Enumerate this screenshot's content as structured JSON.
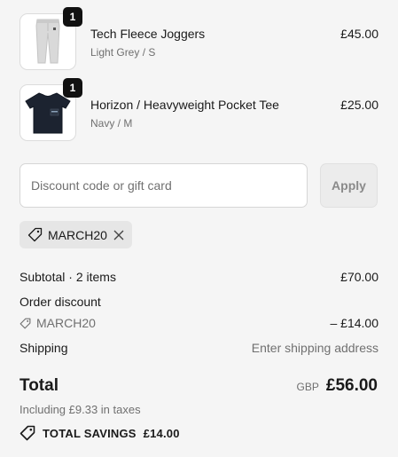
{
  "items": [
    {
      "name": "Tech Fleece Joggers",
      "variant": "Light Grey / S",
      "price": "£45.00",
      "quantity": "1",
      "image": "joggers-image"
    },
    {
      "name": "Horizon / Heavyweight Pocket Tee",
      "variant": "Navy / M",
      "price": "£25.00",
      "quantity": "1",
      "image": "tee-image"
    }
  ],
  "discount": {
    "placeholder": "Discount code or gift card",
    "apply_label": "Apply",
    "applied_code": "MARCH20"
  },
  "summary": {
    "subtotal_label": "Subtotal · 2 items",
    "subtotal_value": "£70.00",
    "order_discount_label": "Order discount",
    "discount_code": "MARCH20",
    "discount_value": "– £14.00",
    "shipping_label": "Shipping",
    "shipping_value": "Enter shipping address"
  },
  "total": {
    "label": "Total",
    "currency": "GBP",
    "amount": "£56.00",
    "tax_note": "Including £9.33 in taxes",
    "savings_label": "TOTAL SAVINGS",
    "savings_amount": "£14.00"
  },
  "colors": {
    "background": "#f5f5f5",
    "badge": "#111111",
    "muted_text": "#707070"
  }
}
